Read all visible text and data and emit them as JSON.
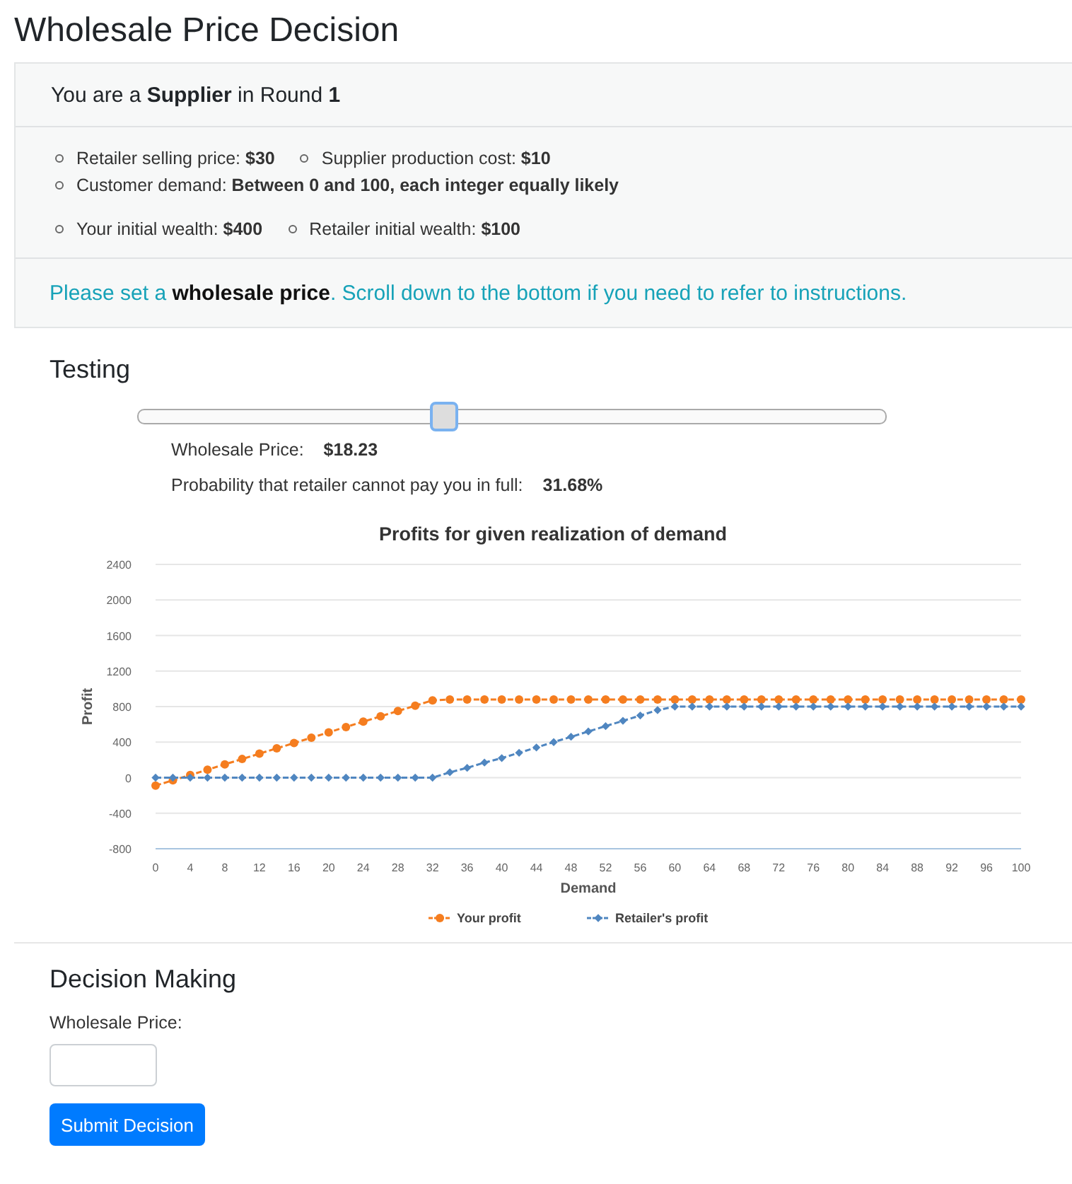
{
  "page_title": "Wholesale Price Decision",
  "info_card": {
    "header": "You are a **Supplier** in Round **1**",
    "info_groups": [
      [
        [
          "Retailer selling price: **$30**",
          "Supplier production cost: **$10**"
        ],
        [
          "Customer demand: **Between 0 and 100, each integer equally likely**"
        ]
      ],
      [
        [
          "Your initial wealth: **$400**",
          "Retailer initial wealth: **$100**"
        ]
      ]
    ],
    "notice": "Please set a **wholesale price**. Scroll down to the bottom if you need to refer to instructions."
  },
  "testing": {
    "heading": "Testing",
    "slider": {
      "level": 0.41
    },
    "readouts": [
      {
        "label": "Wholesale Price:",
        "value": "$18.23"
      },
      {
        "label": "Probability that retailer cannot pay you in full:",
        "value": "31.68%"
      }
    ],
    "chart_data": {
      "type": "line",
      "title": "Profits for given realization of demand",
      "xlabel": "Demand",
      "ylabel": "Profit",
      "x": [
        0,
        2,
        4,
        6,
        8,
        10,
        12,
        14,
        16,
        18,
        20,
        22,
        24,
        26,
        28,
        30,
        32,
        34,
        36,
        38,
        40,
        42,
        44,
        46,
        48,
        50,
        52,
        54,
        56,
        58,
        60,
        62,
        64,
        66,
        68,
        70,
        72,
        74,
        76,
        78,
        80,
        82,
        84,
        86,
        88,
        90,
        92,
        94,
        96,
        98,
        100
      ],
      "series": [
        {
          "name": "Your profit",
          "color": "#f57d1f",
          "line_style": "dashed",
          "marker": "circle",
          "values": [
            -90,
            -30,
            30,
            90,
            150,
            210,
            270,
            330,
            390,
            450,
            510,
            570,
            630,
            690,
            750,
            810,
            870,
            880,
            880,
            880,
            880,
            880,
            880,
            880,
            880,
            880,
            880,
            880,
            880,
            880,
            880,
            880,
            880,
            880,
            880,
            880,
            880,
            880,
            880,
            880,
            880,
            880,
            880,
            880,
            880,
            880,
            880,
            880,
            880,
            880,
            880
          ]
        },
        {
          "name": "Retailer's profit",
          "color": "#4f86c0",
          "line_style": "dashed",
          "marker": "diamond",
          "values": [
            0,
            0,
            0,
            0,
            0,
            0,
            0,
            0,
            0,
            0,
            0,
            0,
            0,
            0,
            0,
            0,
            0,
            60,
            110,
            170,
            220,
            280,
            340,
            400,
            460,
            520,
            580,
            640,
            700,
            760,
            800,
            800,
            800,
            800,
            800,
            800,
            800,
            800,
            800,
            800,
            800,
            800,
            800,
            800,
            800,
            800,
            800,
            800,
            800,
            800,
            800
          ]
        }
      ],
      "grid": true,
      "legend": true,
      "xlim": [
        0,
        100
      ],
      "ylim": [
        -800,
        2400
      ],
      "xticks": [
        0,
        4,
        8,
        12,
        16,
        20,
        24,
        28,
        32,
        36,
        40,
        44,
        48,
        52,
        56,
        60,
        64,
        68,
        72,
        76,
        80,
        84,
        88,
        92,
        96,
        100
      ],
      "yticks": [
        -800,
        -400,
        0,
        400,
        800,
        1200,
        1600,
        2000,
        2400
      ]
    }
  },
  "decision": {
    "heading": "Decision Making",
    "field_label": "Wholesale Price:",
    "submit_label": "Submit Decision"
  }
}
